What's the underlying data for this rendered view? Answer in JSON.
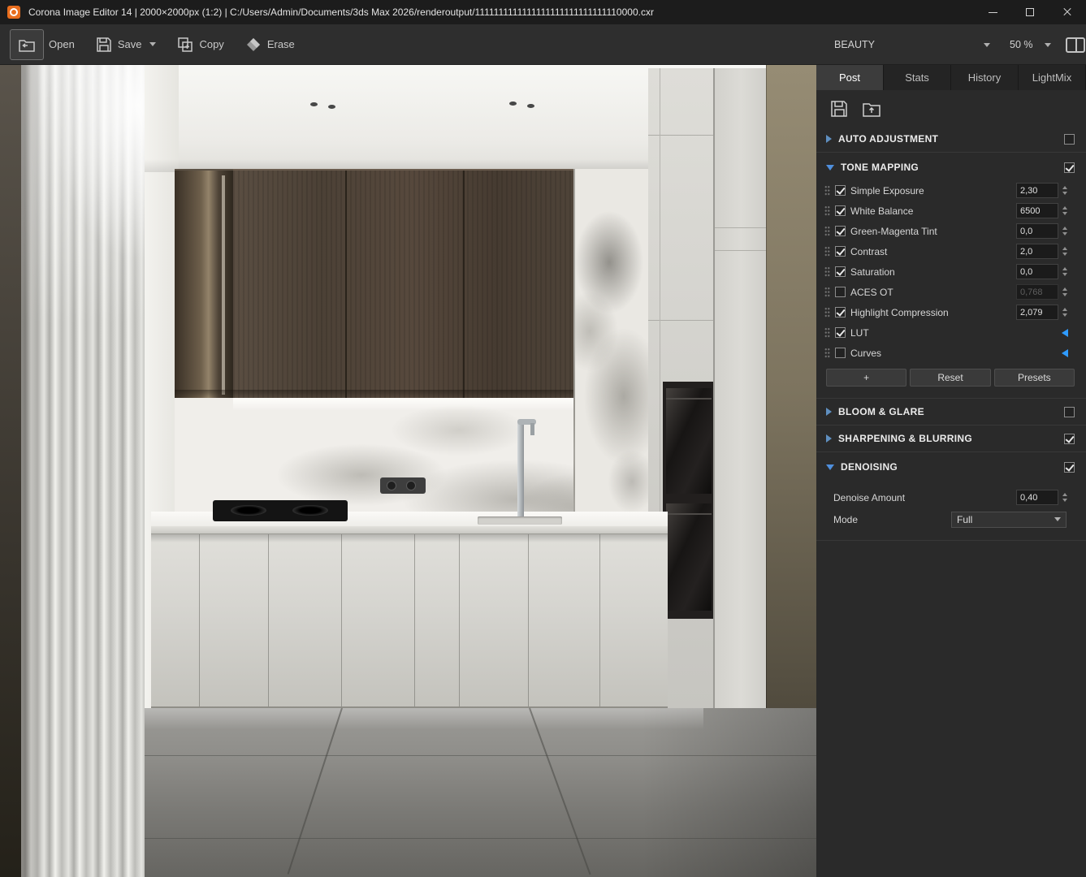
{
  "window": {
    "title": "Corona Image Editor 14 | 2000×2000px (1:2) | C:/Users/Admin/Documents/3ds Max 2026/renderoutput/1111111111111111111111111111110000.cxr"
  },
  "toolbar": {
    "open_label": "Open",
    "save_label": "Save",
    "copy_label": "Copy",
    "erase_label": "Erase",
    "channel_value": "BEAUTY",
    "zoom_value": "50 %"
  },
  "panel": {
    "tabs": [
      {
        "label": "Post"
      },
      {
        "label": "Stats"
      },
      {
        "label": "History"
      },
      {
        "label": "LightMix"
      }
    ],
    "auto_adjustment": {
      "title": "AUTO ADJUSTMENT"
    },
    "tone_mapping": {
      "title": "TONE MAPPING",
      "params": [
        {
          "label": "Simple Exposure",
          "value": "2,30"
        },
        {
          "label": "White Balance",
          "value": "6500"
        },
        {
          "label": "Green-Magenta Tint",
          "value": "0,0"
        },
        {
          "label": "Contrast",
          "value": "2,0"
        },
        {
          "label": "Saturation",
          "value": "0,0"
        },
        {
          "label": "ACES OT",
          "value": "0,768"
        },
        {
          "label": "Highlight Compression",
          "value": "2,079"
        }
      ],
      "lut_label": "LUT",
      "curves_label": "Curves",
      "add_label": "+",
      "reset_label": "Reset",
      "presets_label": "Presets"
    },
    "bloom_glare": {
      "title": "BLOOM & GLARE"
    },
    "sharpening": {
      "title": "SHARPENING & BLURRING"
    },
    "denoising": {
      "title": "DENOISING",
      "amount_label": "Denoise Amount",
      "amount_value": "0,40",
      "mode_label": "Mode",
      "mode_value": "Full"
    }
  }
}
